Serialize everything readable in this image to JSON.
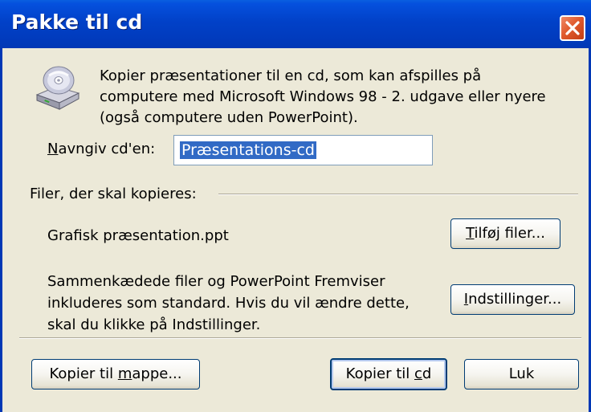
{
  "window": {
    "title": "Pakke til cd"
  },
  "intro": {
    "line1": "Kopier præsentationer til en cd, som kan afspilles på",
    "line2": "computere med Microsoft Windows 98 - 2. udgave eller nyere",
    "line3": "(også computere uden PowerPoint)."
  },
  "name_field": {
    "label_hotkey": "N",
    "label_rest": "avngiv cd'en:",
    "value": "Præsentations-cd"
  },
  "files_section": {
    "label": "Filer, der skal kopieres:",
    "file_name": "Grafisk præsentation.ppt",
    "add_files_hotkey": "T",
    "add_files_rest": "ilføj filer...",
    "linked_line1": "Sammenkædede filer og PowerPoint Fremviser",
    "linked_line2": "inkluderes som standard. Hvis du vil ændre dette,",
    "linked_line3": "skal du klikke på Indstillinger.",
    "options_hotkey": "I",
    "options_rest": "ndstillinger..."
  },
  "footer": {
    "copy_folder_pre": "Kopier til ",
    "copy_folder_hotkey": "m",
    "copy_folder_post": "appe...",
    "copy_cd_pre": "Kopier til ",
    "copy_cd_hotkey": "c",
    "copy_cd_post": "d",
    "close_label": "Luk"
  },
  "colors": {
    "title_bar": "#0141c8",
    "dialog_bg": "#ece9d8",
    "selection": "#316ac5",
    "close_button": "#e05a2e"
  },
  "icons": {
    "app": "cd-drive-icon",
    "close": "close-icon"
  }
}
